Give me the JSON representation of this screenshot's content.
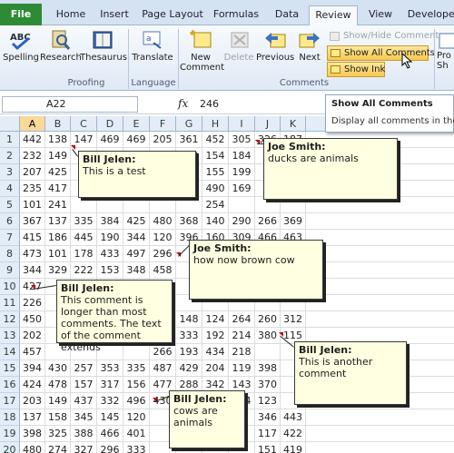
{
  "tabs": [
    "File",
    "Home",
    "Insert",
    "Page Layout",
    "Formulas",
    "Data",
    "Review",
    "View",
    "Developer"
  ],
  "ribbon": {
    "spelling": "Spelling",
    "research": "Research",
    "thesaurus": "Thesaurus",
    "translate": "Translate",
    "new_comment_1": "New",
    "new_comment_2": "Comment",
    "delete": "Delete",
    "previous": "Previous",
    "next": "Next",
    "show_hide": "Show/Hide Comment",
    "show_all": "Show All Comments",
    "show_ink": "Show Ink",
    "protect_1": "Pro",
    "protect_2": "Sh",
    "groups": {
      "proofing": "Proofing",
      "language": "Language",
      "comments": "Comments"
    }
  },
  "tooltip": {
    "title": "Show All Comments",
    "desc": "Display all comments in the s"
  },
  "formula_bar": {
    "name_box": "A22",
    "fx": "fx",
    "value": "246"
  },
  "columns": [
    "A",
    "B",
    "C",
    "D",
    "E",
    "F",
    "G",
    "H",
    "I",
    "J",
    "K"
  ],
  "rows": [
    [
      "1",
      "442",
      "138",
      "147",
      "469",
      "469",
      "205",
      "361",
      "452",
      "305",
      "326",
      "187"
    ],
    [
      "2",
      "232",
      "149",
      "",
      "",
      "",
      "",
      "",
      "",
      "",
      "",
      ""
    ],
    [
      "3",
      "207",
      "425",
      "",
      "",
      "",
      "",
      "",
      "",
      "",
      "",
      ""
    ],
    [
      "4",
      "235",
      "417",
      "",
      "",
      "",
      "",
      "",
      "",
      "",
      "",
      ""
    ],
    [
      "5",
      "101",
      "241",
      "",
      "",
      "",
      "",
      "",
      "",
      "",
      "",
      ""
    ],
    [
      "6",
      "367",
      "137",
      "335",
      "384",
      "425",
      "480",
      "368",
      "140",
      "290",
      "266",
      "369"
    ],
    [
      "7",
      "415",
      "186",
      "445",
      "190",
      "344",
      "120",
      "396",
      "160",
      "309",
      "466",
      "463"
    ],
    [
      "8",
      "473",
      "101",
      "178",
      "433",
      "497",
      "296",
      "",
      "",
      "",
      "",
      ""
    ],
    [
      "9",
      "344",
      "329",
      "222",
      "153",
      "348",
      "458",
      "",
      "",
      "",
      "",
      ""
    ],
    [
      "10",
      "427",
      "",
      "",
      "",
      "",
      "",
      "",
      "",
      "",
      "",
      ""
    ],
    [
      "11",
      "226",
      "",
      "",
      "",
      "",
      "",
      "",
      "",
      "",
      "",
      ""
    ],
    [
      "12",
      "450",
      "",
      "",
      "",
      "",
      "",
      "",
      "",
      "",
      "",
      ""
    ],
    [
      "13",
      "202",
      "",
      "",
      "",
      "",
      "",
      "",
      "",
      "",
      "",
      ""
    ],
    [
      "14",
      "457",
      "",
      "",
      "",
      "",
      "",
      "",
      "",
      "",
      "",
      ""
    ],
    [
      "15",
      "394",
      "430",
      "257",
      "353",
      "335",
      "487",
      "429",
      "204",
      "119",
      "398",
      ""
    ],
    [
      "16",
      "424",
      "478",
      "157",
      "317",
      "156",
      "477",
      "288",
      "342",
      "143",
      "370",
      ""
    ],
    [
      "17",
      "203",
      "149",
      "437",
      "332",
      "496",
      "430",
      "189",
      "458",
      "254",
      "123",
      ""
    ],
    [
      "18",
      "137",
      "158",
      "345",
      "145",
      "120",
      "",
      "",
      "",
      "",
      "",
      ""
    ],
    [
      "19",
      "398",
      "325",
      "388",
      "466",
      "401",
      "",
      "",
      "",
      "",
      "",
      ""
    ],
    [
      "20",
      "480",
      "274",
      "327",
      "296",
      "333",
      "",
      "",
      "",
      "",
      "",
      ""
    ],
    [
      "21",
      "",
      "",
      "",
      "",
      "",
      "",
      "",
      "",
      "",
      "",
      ""
    ]
  ],
  "partial_cells": {
    "r2": [
      "350",
      "",
      "",
      "",
      "",
      "",
      "",
      "",
      "",
      "",
      "",
      ""
    ],
    "r3": [
      "",
      "",
      "",
      "",
      "",
      "",
      "",
      "",
      "",
      "",
      "",
      ""
    ]
  },
  "extra_cells": {
    "row2": [
      "232",
      "149",
      "",
      "",
      "",
      "",
      "",
      "",
      "",
      "",
      "",
      ""
    ],
    "r2_i": "184",
    "r2_h": "154",
    "r2_g": "190",
    "r3_h": "155",
    "r3_i": "199",
    "r4_h": "490",
    "r4_i": "169",
    "r5_h": "254",
    "r5_i": "",
    "r12_g": "148",
    "r12_h": "124",
    "r12_i": "264",
    "r12_j": "260",
    "r12_k": "312",
    "r13_g": "333",
    "r13_h": "192",
    "r13_i": "214",
    "r13_j": "380",
    "r13_k": "115",
    "r14_f": "266",
    "r14_g": "193",
    "r14_h": "434",
    "r14_i": "218",
    "r18_j": "346",
    "r18_k": "443",
    "r19_j": "117",
    "r19_k": "422",
    "r20_j": "151",
    "r20_k": "419"
  },
  "comments": [
    {
      "author": "Bill Jelen:",
      "text": "This is a test"
    },
    {
      "author": "Joe Smith:",
      "text": "ducks are animals"
    },
    {
      "author": "Joe Smith:",
      "text": "how now brown cow"
    },
    {
      "author": "Bill Jelen:",
      "text": "This comment is longer than most comments. The text of the comment extends"
    },
    {
      "author": "Bill Jelen:",
      "text": "This is another comment"
    },
    {
      "author": "Bill Jelen:",
      "text": "cows are animals"
    }
  ]
}
